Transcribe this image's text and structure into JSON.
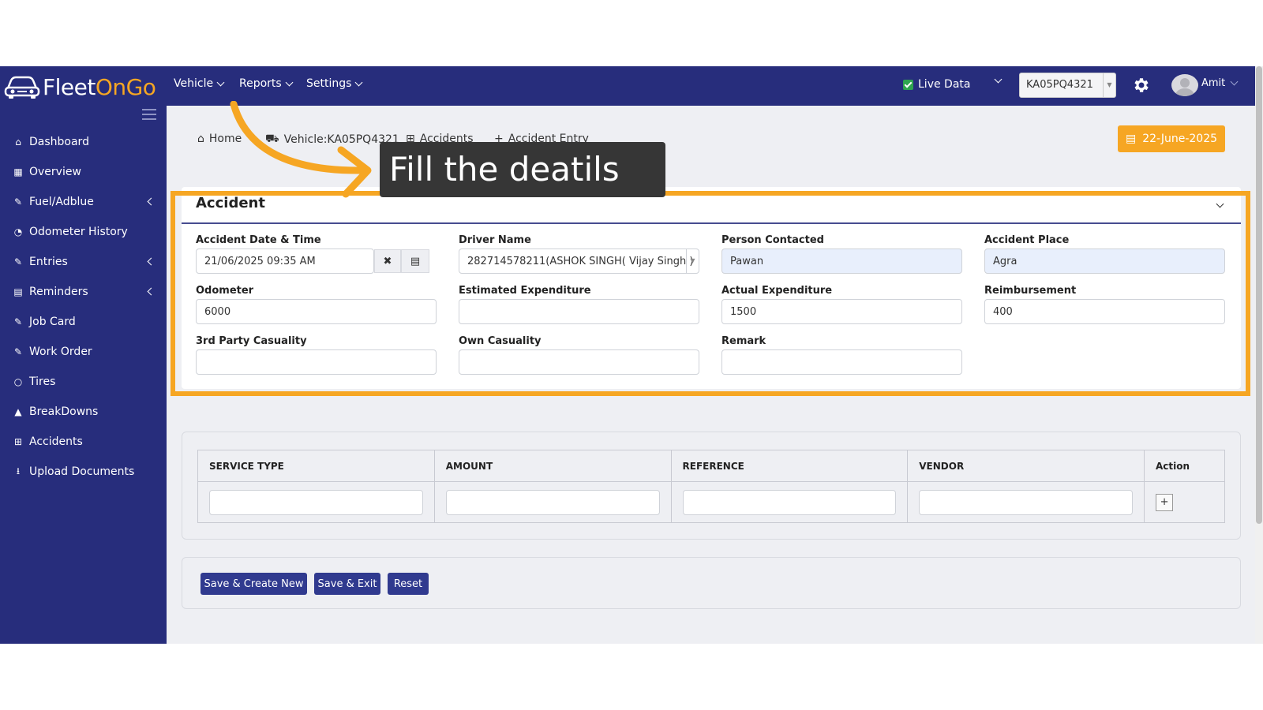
{
  "brand": {
    "part1": "Fleet",
    "part2": "OnGo"
  },
  "topnav": [
    {
      "label": "Vehicle"
    },
    {
      "label": "Reports"
    },
    {
      "label": "Settings"
    }
  ],
  "header": {
    "live_data_label": "Live Data",
    "vehicle_selected": "KA05PQ4321",
    "user_name": "Amit"
  },
  "sidebar": {
    "items": [
      {
        "label": "Dashboard",
        "icon": "home-icon"
      },
      {
        "label": "Overview",
        "icon": "grid-icon"
      },
      {
        "label": "Fuel/Adblue",
        "icon": "edit-icon",
        "expandable": true
      },
      {
        "label": "Odometer History",
        "icon": "gauge-icon"
      },
      {
        "label": "Entries",
        "icon": "edit-icon",
        "expandable": true
      },
      {
        "label": "Reminders",
        "icon": "calendar-icon",
        "expandable": true
      },
      {
        "label": "Job Card",
        "icon": "edit-icon"
      },
      {
        "label": "Work Order",
        "icon": "edit-icon"
      },
      {
        "label": "Tires",
        "icon": "circle-icon"
      },
      {
        "label": "BreakDowns",
        "icon": "warning-icon"
      },
      {
        "label": "Accidents",
        "icon": "plus-square-icon"
      },
      {
        "label": "Upload Documents",
        "icon": "download-icon"
      }
    ]
  },
  "breadcrumb": {
    "home": "Home",
    "vehicle": "Vehicle:KA05PQ4321",
    "accidents": "Accidents",
    "current": "Accident Entry"
  },
  "date_badge": "22-June-2025",
  "annotation": {
    "text": "Fill the deatils"
  },
  "form": {
    "title": "Accident",
    "fields": {
      "accident_datetime": {
        "label": "Accident Date & Time",
        "value": "21/06/2025 09:35 AM"
      },
      "driver_name": {
        "label": "Driver Name",
        "value": "282714578211(ASHOK SINGH( Vijay Singh )"
      },
      "person_contacted": {
        "label": "Person Contacted",
        "value": "Pawan"
      },
      "accident_place": {
        "label": "Accident Place",
        "value": "Agra"
      },
      "odometer": {
        "label": "Odometer",
        "value": "6000"
      },
      "estimated_expenditure": {
        "label": "Estimated Expenditure",
        "value": ""
      },
      "actual_expenditure": {
        "label": "Actual Expenditure",
        "value": "1500"
      },
      "reimbursement": {
        "label": "Reimbursement",
        "value": "400"
      },
      "third_party_casualty": {
        "label": "3rd Party Casuality",
        "value": ""
      },
      "own_casualty": {
        "label": "Own Casuality",
        "value": ""
      },
      "remark": {
        "label": "Remark",
        "value": ""
      }
    }
  },
  "service_table": {
    "columns": [
      "SERVICE TYPE",
      "AMOUNT",
      "REFERENCE",
      "VENDOR",
      "Action"
    ],
    "add_label": "+"
  },
  "buttons": {
    "save_create_new": "Save & Create New",
    "save_exit": "Save & Exit",
    "reset": "Reset"
  },
  "colors": {
    "nav_bg": "#272d7c",
    "accent": "#f6a623",
    "button": "#303a8f"
  }
}
